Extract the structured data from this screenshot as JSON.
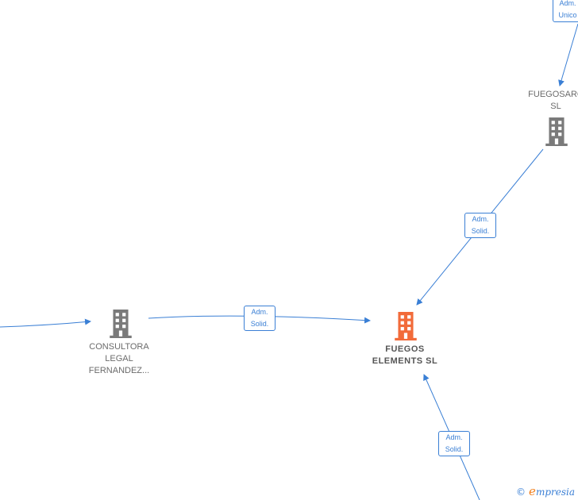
{
  "nodes": {
    "fuegosarc": {
      "lines": [
        "FUEGOSARC",
        "SL"
      ],
      "color": "#7a7a7a"
    },
    "consultora": {
      "lines": [
        "CONSULTORA",
        "LEGAL",
        "FERNANDEZ..."
      ],
      "color": "#7a7a7a"
    },
    "fuegos": {
      "lines": [
        "FUEGOS",
        "ELEMENTS  SL"
      ],
      "color": "#f26b3a"
    }
  },
  "edges": [
    {
      "label": [
        "Adm.",
        "Unico"
      ]
    },
    {
      "label": [
        "Adm.",
        "Solid."
      ]
    },
    {
      "label": [
        "Adm.",
        "Solid."
      ]
    },
    {
      "label": [
        "Adm.",
        "Solid."
      ]
    }
  ],
  "colors": {
    "edge": "#3a7fd5"
  },
  "watermark": {
    "copyright": "©",
    "brand_initial": "e",
    "brand_rest": "mpresia"
  }
}
